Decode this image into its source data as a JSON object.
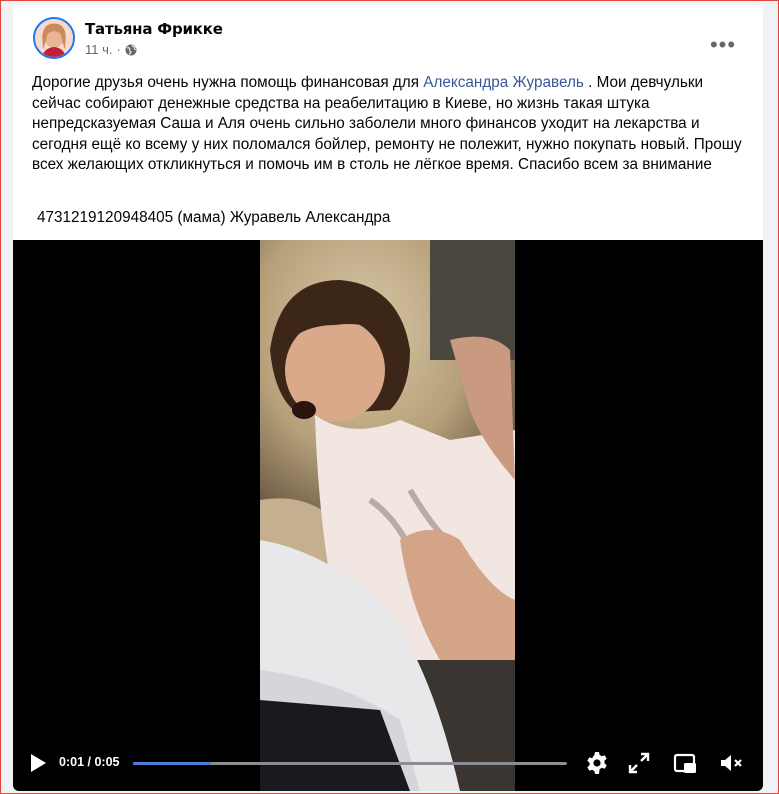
{
  "post": {
    "author": "Татьяна Фрикке",
    "time": "11 ч.",
    "separator": "·",
    "privacy_icon": "globe-icon",
    "more_label": "•••",
    "text_before": "Дорогие друзья очень нужна помощь финансовая для ",
    "mention": "Александра Журавель",
    "text_after": " . Мои девчульки сейчас собирают денежные средства на реабелитацию в Киеве, но жизнь такая штука непредсказуемая Саша и Аля очень сильно заболели много финансов уходит на лекарства и сегодня ещё ко всему у них поломался бойлер, ремонту не полежит, нужно покупать новый. Прошу всех желающих  откликнуться и помочь им в столь не лёгкое время. Спасибо всем за внимание",
    "account_line": "4731219120948405  (мама) Журавель Александра"
  },
  "video": {
    "current_time": "0:01",
    "time_separator": " / ",
    "duration": "0:05",
    "progress": 0.18,
    "icons": [
      "play-icon",
      "gear-icon",
      "fullscreen-expand-icon",
      "picture-in-picture-icon",
      "volume-muted-icon"
    ]
  },
  "colors": {
    "accent": "#1877f2",
    "mention": "#385898",
    "progress": "#4e7fd6",
    "frame_border": "#e0473e"
  }
}
